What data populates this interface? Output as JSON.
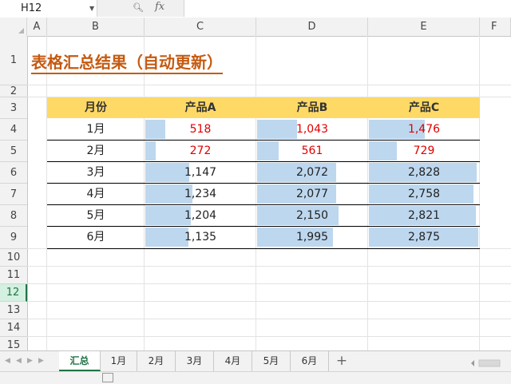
{
  "formula_bar": {
    "name_box": "H12",
    "fx": "fx"
  },
  "columns": [
    "A",
    "B",
    "C",
    "D",
    "E",
    "F"
  ],
  "rows": [
    "1",
    "2",
    "3",
    "4",
    "5",
    "6",
    "7",
    "8",
    "9",
    "10",
    "11",
    "12",
    "13",
    "14",
    "15"
  ],
  "active_row": "12",
  "sheet": {
    "title": "表格汇总结果（自动更新）",
    "headers": [
      "月份",
      "产品A",
      "产品B",
      "产品C"
    ],
    "data": [
      {
        "month": "1月",
        "values": [
          518,
          1043
        ],
        "labels": [
          "518",
          "1,043",
          "1,476"
        ],
        "c": 1476,
        "a": 518,
        "b": 1043,
        "highlight": true
      },
      {
        "month": "2月",
        "a": 272,
        "b": 561,
        "c": 729,
        "labels": [
          "272",
          "561",
          "729"
        ],
        "highlight": true
      },
      {
        "month": "3月",
        "a": 1147,
        "b": 2072,
        "c": 2828,
        "labels": [
          "1,147",
          "2,072",
          "2,828"
        ],
        "highlight": false
      },
      {
        "month": "4月",
        "a": 1234,
        "b": 2077,
        "c": 2758,
        "labels": [
          "1,234",
          "2,077",
          "2,758"
        ],
        "highlight": false
      },
      {
        "month": "5月",
        "a": 1204,
        "b": 2150,
        "c": 2821,
        "labels": [
          "1,204",
          "2,150",
          "2,821"
        ],
        "highlight": false
      },
      {
        "month": "6月",
        "a": 1135,
        "b": 1995,
        "c": 2875,
        "labels": [
          "1,135",
          "1,995",
          "2,875"
        ],
        "highlight": false
      }
    ],
    "bar_max": 2900,
    "colors": {
      "title": "#c55a11",
      "header_bg": "#ffd966",
      "bar": "#bdd7ee",
      "highlight_text": "#e00000",
      "normal_text": "#222222"
    }
  },
  "tabs": [
    "汇总",
    "1月",
    "2月",
    "3月",
    "4月",
    "5月",
    "6月"
  ],
  "active_tab": "汇总",
  "add_sheet": "+"
}
